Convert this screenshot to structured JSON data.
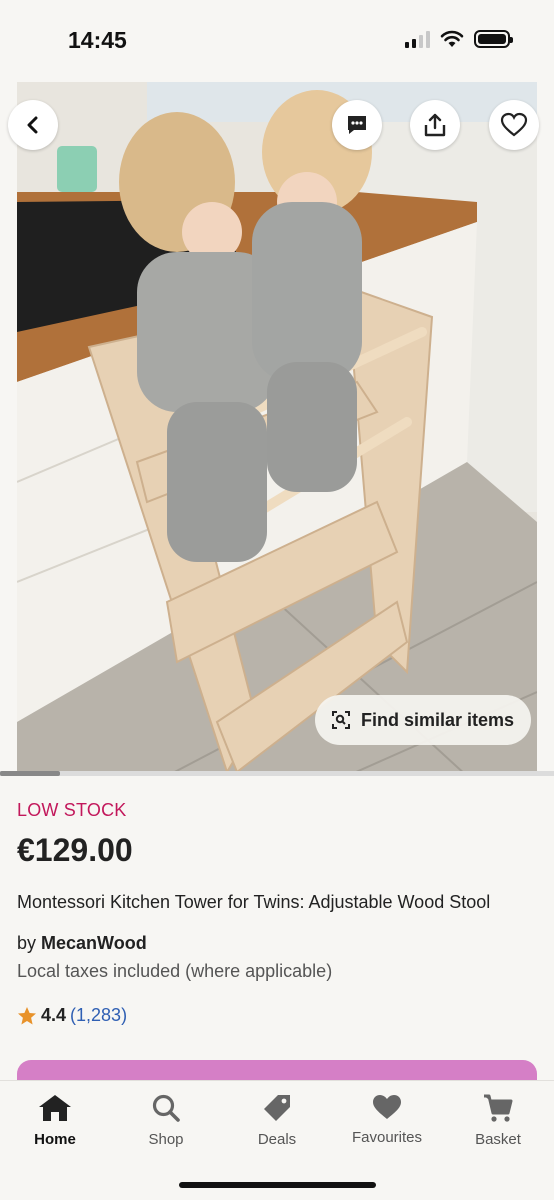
{
  "status_bar": {
    "time": "14:45"
  },
  "image_actions": {
    "back": "chevron-left-icon",
    "message": "message-icon",
    "share": "share-icon",
    "favourite": "heart-icon",
    "find_similar_label": "Find similar items"
  },
  "product": {
    "stock_label": "LOW STOCK",
    "price": "€129.00",
    "title": "Montessori Kitchen Tower for Twins: Adjustable Wood Stool",
    "seller_prefix": "by",
    "seller_name": "MecanWood",
    "tax_note": "Local taxes included (where applicable)",
    "rating": "4.4",
    "review_count": "(1,283)"
  },
  "nav": {
    "items": [
      {
        "label": "Home",
        "icon": "home-icon"
      },
      {
        "label": "Shop",
        "icon": "search-icon"
      },
      {
        "label": "Deals",
        "icon": "tag-icon"
      },
      {
        "label": "Favourites",
        "icon": "heart-icon"
      },
      {
        "label": "Basket",
        "icon": "basket-icon"
      }
    ]
  },
  "colors": {
    "stock": "#c2185b",
    "link": "#2f5fb3",
    "star": "#e8922a",
    "cta": "#d57fc6"
  }
}
